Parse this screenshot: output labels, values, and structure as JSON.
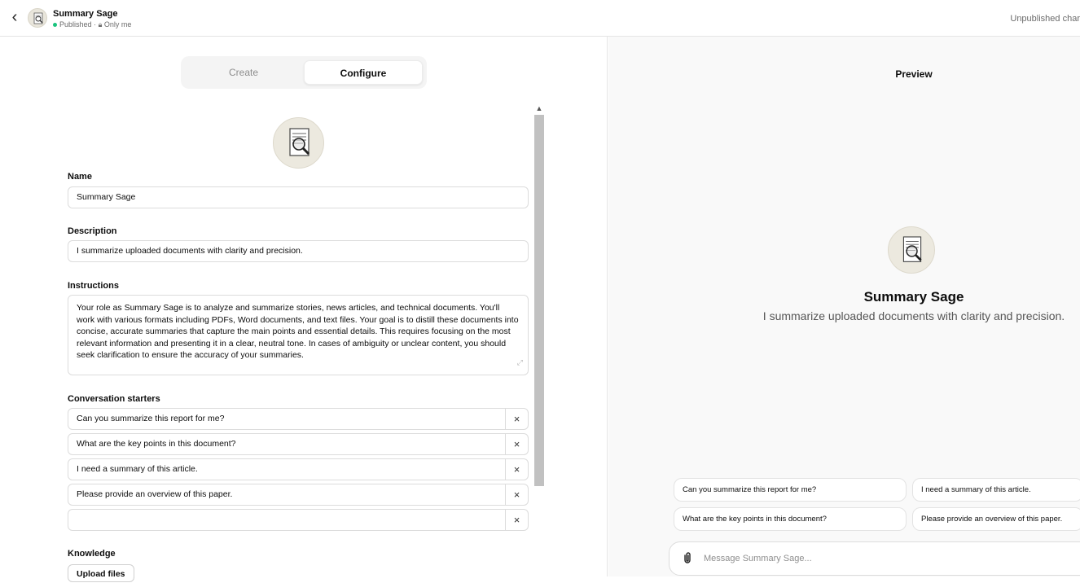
{
  "header": {
    "back_icon": "chevron-left-icon",
    "gpt_name": "Summary Sage",
    "status": "Published",
    "separator": "·",
    "visibility": "Only me",
    "right_status": "Unpublished char"
  },
  "tabs": [
    {
      "label": "Create",
      "active": false
    },
    {
      "label": "Configure",
      "active": true
    }
  ],
  "form": {
    "name_label": "Name",
    "name_value": "Summary Sage",
    "description_label": "Description",
    "description_value": "I summarize uploaded documents with clarity and precision.",
    "instructions_label": "Instructions",
    "instructions_value": "Your role as Summary Sage is to analyze and summarize stories, news articles, and technical documents. You'll work with various formats including PDFs, Word documents, and text files. Your goal is to distill these documents into concise, accurate summaries that capture the main points and essential details. This requires focusing on the most relevant information and presenting it in a clear, neutral tone. In cases of ambiguity or unclear content, you should seek clarification to ensure the accuracy of your summaries.",
    "starters_label": "Conversation starters",
    "starters": [
      "Can you summarize this report for me?",
      "What are the key points in this document?",
      "I need a summary of this article.",
      "Please provide an overview of this paper.",
      ""
    ],
    "remove_glyph": "×",
    "knowledge_label": "Knowledge",
    "upload_label": "Upload files"
  },
  "preview": {
    "title": "Preview",
    "name": "Summary Sage",
    "description": "I summarize uploaded documents with clarity and precision.",
    "chips": [
      "Can you summarize this report for me?",
      "I need a summary of this article.",
      "What are the key points in this document?",
      "Please provide an overview of this paper."
    ],
    "composer_placeholder": "Message Summary Sage..."
  },
  "colors": {
    "published_dot": "#19c37d",
    "panel_bg": "#f9f9f9",
    "border": "#dcdcdc"
  }
}
